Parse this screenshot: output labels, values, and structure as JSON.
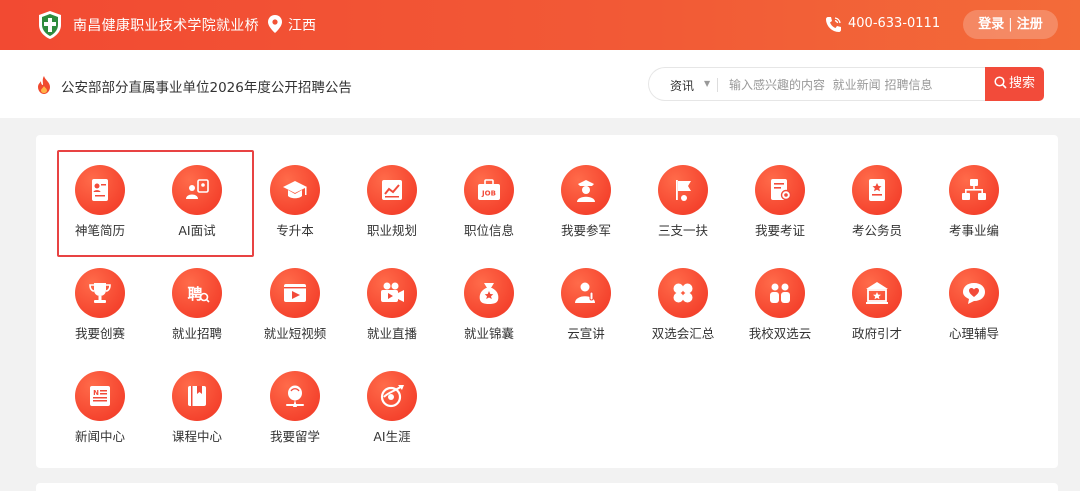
{
  "header": {
    "site_title": "南昌健康职业技术学院就业桥",
    "location": "江西",
    "phone": "400-633-0111",
    "login_label": "登录",
    "register_label": "注册",
    "separator": "|"
  },
  "notice": {
    "text": "公安部部分直属事业单位2026年度公开招聘公告"
  },
  "search": {
    "category": "资讯",
    "placeholder": "输入感兴趣的内容  就业新闻 招聘信息",
    "button_label": "搜索"
  },
  "colors": {
    "brand": "#f24b3a",
    "highlight_border": "#e84343"
  },
  "services": [
    {
      "label": "神笔简历",
      "icon": "resume-icon"
    },
    {
      "label": "AI面试",
      "icon": "ai-interview-icon"
    },
    {
      "label": "专升本",
      "icon": "graduation-cap-icon"
    },
    {
      "label": "职业规划",
      "icon": "career-plan-icon"
    },
    {
      "label": "职位信息",
      "icon": "job-icon"
    },
    {
      "label": "我要参军",
      "icon": "soldier-icon"
    },
    {
      "label": "三支一扶",
      "icon": "flag-icon"
    },
    {
      "label": "我要考证",
      "icon": "certificate-icon"
    },
    {
      "label": "考公务员",
      "icon": "civil-exam-icon"
    },
    {
      "label": "考事业编",
      "icon": "org-chart-icon"
    },
    {
      "label": "我要创赛",
      "icon": "trophy-icon"
    },
    {
      "label": "就业招聘",
      "icon": "recruit-icon"
    },
    {
      "label": "就业短视频",
      "icon": "video-icon"
    },
    {
      "label": "就业直播",
      "icon": "live-camera-icon"
    },
    {
      "label": "就业锦囊",
      "icon": "tips-bag-icon"
    },
    {
      "label": "云宣讲",
      "icon": "presenter-icon"
    },
    {
      "label": "双选会汇总",
      "icon": "grid-circles-icon"
    },
    {
      "label": "我校双选云",
      "icon": "people-icon"
    },
    {
      "label": "政府引才",
      "icon": "government-icon"
    },
    {
      "label": "心理辅导",
      "icon": "heart-chat-icon"
    },
    {
      "label": "新闻中心",
      "icon": "news-icon"
    },
    {
      "label": "课程中心",
      "icon": "course-book-icon"
    },
    {
      "label": "我要留学",
      "icon": "study-abroad-icon"
    },
    {
      "label": "AI生涯",
      "icon": "ai-career-icon"
    }
  ]
}
